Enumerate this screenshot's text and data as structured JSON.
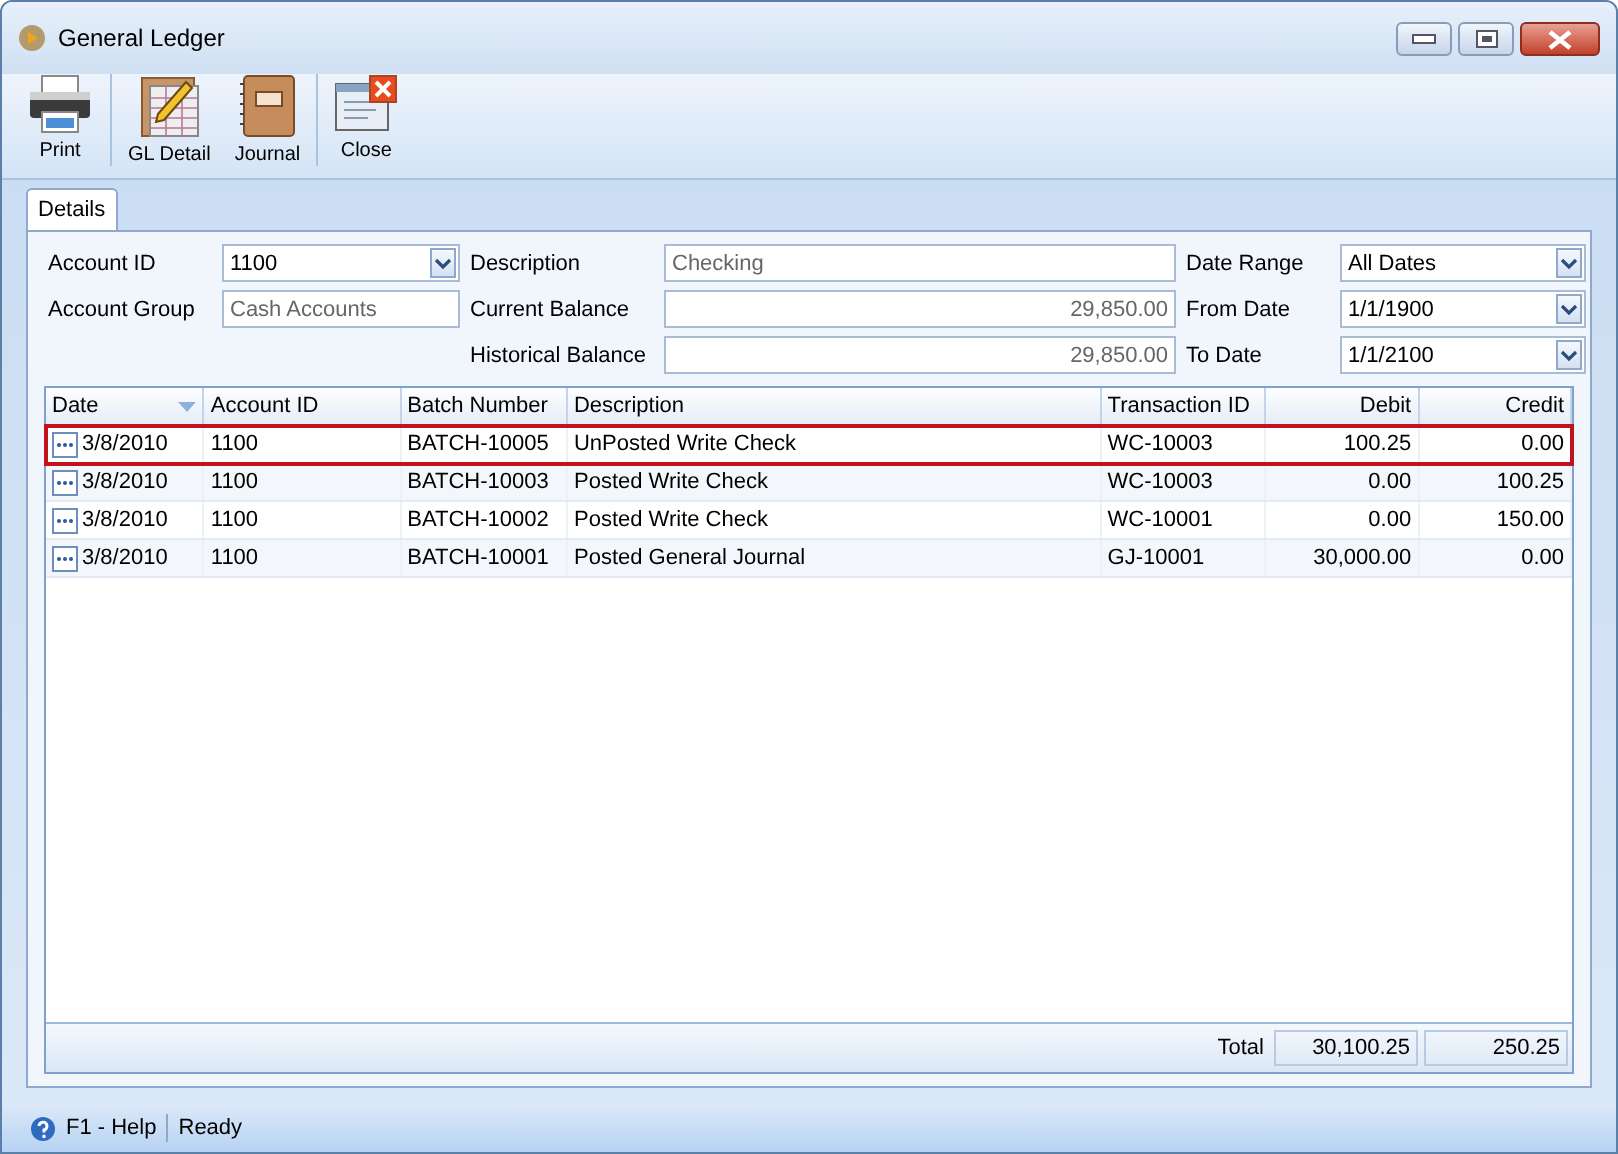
{
  "window": {
    "title": "General Ledger"
  },
  "toolbar": [
    {
      "label": "Print",
      "kind": "printer"
    },
    {
      "label": "GL Detail",
      "kind": "ledger"
    },
    {
      "label": "Journal",
      "kind": "journal"
    },
    {
      "label": "Close",
      "kind": "close"
    }
  ],
  "tabs": [
    {
      "label": "Details",
      "selected": true
    }
  ],
  "form": {
    "account_id": {
      "label": "Account ID",
      "value": "1100"
    },
    "account_group": {
      "label": "Account Group",
      "value": "Cash Accounts"
    },
    "description": {
      "label": "Description",
      "value": "Checking"
    },
    "current_balance": {
      "label": "Current Balance",
      "value": "29,850.00"
    },
    "historical_balance": {
      "label": "Historical Balance",
      "value": "29,850.00"
    },
    "date_range": {
      "label": "Date Range",
      "value": "All Dates"
    },
    "from_date": {
      "label": "From Date",
      "value": "1/1/1900"
    },
    "to_date": {
      "label": "To Date",
      "value": "1/1/2100"
    }
  },
  "table": {
    "columns": [
      {
        "label": "Date",
        "sorted": true
      },
      {
        "label": "Account ID",
        "sorted": false
      },
      {
        "label": "Batch Number",
        "sorted": false
      },
      {
        "label": "Description",
        "sorted": false
      },
      {
        "label": "Transaction ID",
        "sorted": false
      },
      {
        "label": "Debit",
        "sorted": false
      },
      {
        "label": "Credit",
        "sorted": false
      }
    ],
    "rows": [
      {
        "selected": true,
        "cells": [
          "3/8/2010",
          "1100",
          "BATCH-10005",
          "UnPosted Write Check",
          "WC-10003",
          "100.25",
          "0.00"
        ]
      },
      {
        "selected": false,
        "cells": [
          "3/8/2010",
          "1100",
          "BATCH-10003",
          "Posted Write Check",
          "WC-10003",
          "0.00",
          "100.25"
        ]
      },
      {
        "selected": false,
        "cells": [
          "3/8/2010",
          "1100",
          "BATCH-10002",
          "Posted Write Check",
          "WC-10001",
          "0.00",
          "150.00"
        ]
      },
      {
        "selected": false,
        "cells": [
          "3/8/2010",
          "1100",
          "BATCH-10001",
          "Posted General Journal",
          "GJ-10001",
          "30,000.00",
          "0.00"
        ]
      }
    ],
    "footer": {
      "label": "Total",
      "debit": "30,100.25",
      "credit": "250.25"
    }
  },
  "status_bar": {
    "help": "F1 - Help",
    "status": "Ready"
  }
}
